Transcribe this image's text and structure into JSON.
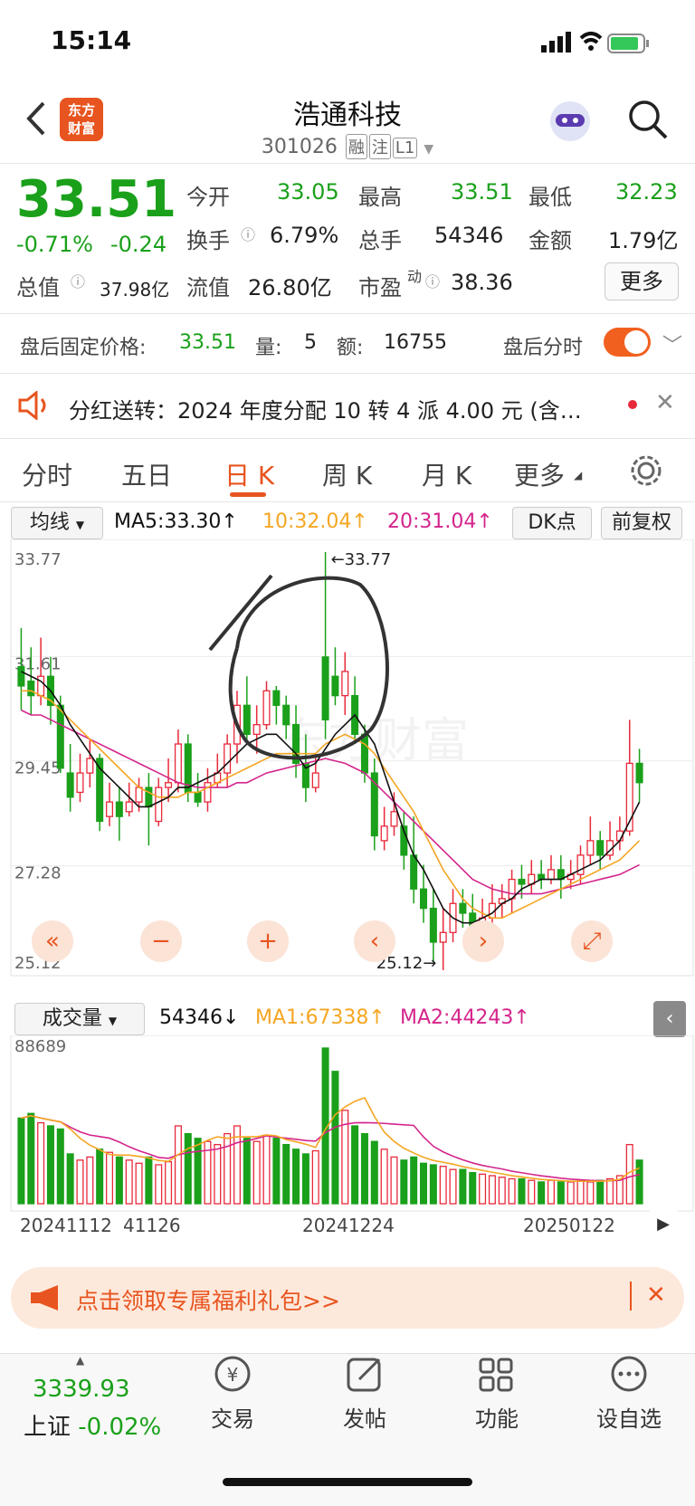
{
  "status": {
    "time": "15:14"
  },
  "header": {
    "title": "浩通科技",
    "code": "301026",
    "tags": [
      "融",
      "注",
      "L1"
    ],
    "logo_text": "东方财富"
  },
  "quote": {
    "price": "33.51",
    "change_pct": "-0.71%",
    "change": "-0.24",
    "fields": [
      {
        "label": "今开",
        "value": "33.05"
      },
      {
        "label": "最高",
        "value": "33.51"
      },
      {
        "label": "最低",
        "value": "32.23"
      },
      {
        "label": "换手",
        "value": "6.79%"
      },
      {
        "label": "总手",
        "value": "54346"
      },
      {
        "label": "金额",
        "value": "1.79亿"
      },
      {
        "label": "总值",
        "value": "37.98亿"
      },
      {
        "label": "流值",
        "value": "26.80亿"
      },
      {
        "label": "市盈",
        "value": "38.36"
      }
    ],
    "pe_sup": "动",
    "more_label": "更多"
  },
  "after_hours": {
    "label": "盘后固定价格:",
    "price": "33.51",
    "vol_label": "量:",
    "vol": "5",
    "amt_label": "额:",
    "amt": "16755",
    "switch_label": "盘后分时"
  },
  "notice": {
    "text": "分红送转：2024 年度分配 10 转 4 派 4.00 元 (含…"
  },
  "tabs": [
    "分时",
    "五日",
    "日 K",
    "周 K",
    "月 K",
    "更多"
  ],
  "ma_bar": {
    "select": "均线",
    "ma5": "MA5:33.30↑",
    "ma10": "10:32.04↑",
    "ma20": "20:31.04↑",
    "dk": "DK点",
    "adj": "前复权"
  },
  "price_axis": [
    "33.77",
    "31.61",
    "29.45",
    "27.28",
    "25.12"
  ],
  "annotations": {
    "high": "←33.77",
    "low": "25.12→"
  },
  "vol_bar": {
    "select": "成交量",
    "vol": "54346↓",
    "ma1": "MA1:67338↑",
    "ma2": "MA2:44243↑",
    "max": "88689"
  },
  "dates": [
    "20241112",
    "41126",
    "20241224",
    "20250122"
  ],
  "banner": {
    "text": "点击领取专属福利礼包>>"
  },
  "bottom": {
    "index_value": "3339.93",
    "index_name": "上证",
    "index_change": "-0.02%",
    "items": [
      "交易",
      "发帖",
      "功能",
      "设自选"
    ]
  },
  "colors": {
    "up": "#e8293a",
    "down": "#1aa01a",
    "ma5": "#111111",
    "ma10": "#f5a623",
    "ma20": "#d4258c",
    "accent": "#e8541f"
  },
  "chart_data": {
    "type": "candlestick",
    "price_range": [
      25.12,
      33.77
    ],
    "volume_max": 88689,
    "candles": [
      [
        31.4,
        31.0,
        32.2,
        30.5,
        "d"
      ],
      [
        31.1,
        30.8,
        31.8,
        30.4,
        "d"
      ],
      [
        30.8,
        31.2,
        32.0,
        30.6,
        "u"
      ],
      [
        31.2,
        30.6,
        31.6,
        30.2,
        "d"
      ],
      [
        30.6,
        29.3,
        30.8,
        29.2,
        "d"
      ],
      [
        29.2,
        28.7,
        29.8,
        28.4,
        "d"
      ],
      [
        28.8,
        29.2,
        29.6,
        28.6,
        "u"
      ],
      [
        29.2,
        29.5,
        29.9,
        28.9,
        "u"
      ],
      [
        29.5,
        28.2,
        29.6,
        28.0,
        "d"
      ],
      [
        28.3,
        28.6,
        29.0,
        28.1,
        "u"
      ],
      [
        28.6,
        28.3,
        28.9,
        27.8,
        "d"
      ],
      [
        28.4,
        28.6,
        29.0,
        28.3,
        "u"
      ],
      [
        28.6,
        28.9,
        29.1,
        28.4,
        "u"
      ],
      [
        28.9,
        28.5,
        29.2,
        27.7,
        "d"
      ],
      [
        28.2,
        28.9,
        29.1,
        28.1,
        "u"
      ],
      [
        28.9,
        29.0,
        29.5,
        28.6,
        "u"
      ],
      [
        29.0,
        29.8,
        30.1,
        28.8,
        "u"
      ],
      [
        29.8,
        28.8,
        30.0,
        28.6,
        "d"
      ],
      [
        28.8,
        28.6,
        29.2,
        28.5,
        "d"
      ],
      [
        28.6,
        29.0,
        29.3,
        28.4,
        "u"
      ],
      [
        29.0,
        29.2,
        29.6,
        28.9,
        "u"
      ],
      [
        29.2,
        29.8,
        30.0,
        28.9,
        "u"
      ],
      [
        29.8,
        30.6,
        30.9,
        29.4,
        "u"
      ],
      [
        30.6,
        30.0,
        31.2,
        29.8,
        "d"
      ],
      [
        30.0,
        30.2,
        30.6,
        29.6,
        "u"
      ],
      [
        30.2,
        30.9,
        31.1,
        30.1,
        "u"
      ],
      [
        30.9,
        30.6,
        31.0,
        30.2,
        "d"
      ],
      [
        30.6,
        30.2,
        30.8,
        29.9,
        "d"
      ],
      [
        30.2,
        29.4,
        30.6,
        29.1,
        "d"
      ],
      [
        29.4,
        28.9,
        30.0,
        28.6,
        "d"
      ],
      [
        28.9,
        29.2,
        29.6,
        28.8,
        "u"
      ],
      [
        30.3,
        31.6,
        33.77,
        29.9,
        "d"
      ],
      [
        31.2,
        30.8,
        31.8,
        30.6,
        "d"
      ],
      [
        30.8,
        31.3,
        31.7,
        30.4,
        "u"
      ],
      [
        30.8,
        30.0,
        31.2,
        29.8,
        "d"
      ],
      [
        30.0,
        29.2,
        30.2,
        29.0,
        "d"
      ],
      [
        29.2,
        27.9,
        29.5,
        27.6,
        "d"
      ],
      [
        27.8,
        28.1,
        28.5,
        27.6,
        "u"
      ],
      [
        28.1,
        28.4,
        28.8,
        27.9,
        "u"
      ],
      [
        28.1,
        27.5,
        28.4,
        27.2,
        "d"
      ],
      [
        27.5,
        26.8,
        28.3,
        26.5,
        "d"
      ],
      [
        26.8,
        26.4,
        27.3,
        26.1,
        "d"
      ],
      [
        26.4,
        25.7,
        26.8,
        25.3,
        "d"
      ],
      [
        25.7,
        25.9,
        26.4,
        25.12,
        "u"
      ],
      [
        25.9,
        26.5,
        26.8,
        25.7,
        "u"
      ],
      [
        26.5,
        26.3,
        26.8,
        26.0,
        "d"
      ],
      [
        26.3,
        25.9,
        26.7,
        25.5,
        "d"
      ],
      [
        25.9,
        26.2,
        26.6,
        25.6,
        "u"
      ],
      [
        26.2,
        26.5,
        26.9,
        26.0,
        "u"
      ],
      [
        26.5,
        26.6,
        26.9,
        26.2,
        "u"
      ],
      [
        26.6,
        27.0,
        27.2,
        26.3,
        "u"
      ],
      [
        27.0,
        26.9,
        27.3,
        26.6,
        "d"
      ],
      [
        26.9,
        27.1,
        27.4,
        26.7,
        "u"
      ],
      [
        27.1,
        27.0,
        27.4,
        26.8,
        "d"
      ],
      [
        27.0,
        27.2,
        27.5,
        26.9,
        "u"
      ],
      [
        27.2,
        27.0,
        27.5,
        26.6,
        "d"
      ],
      [
        27.0,
        27.1,
        27.4,
        26.8,
        "u"
      ],
      [
        27.1,
        27.5,
        27.7,
        26.9,
        "u"
      ],
      [
        27.5,
        27.8,
        28.3,
        27.3,
        "u"
      ],
      [
        27.8,
        27.5,
        28.0,
        27.2,
        "d"
      ],
      [
        27.5,
        27.8,
        28.2,
        27.4,
        "u"
      ],
      [
        27.8,
        28.0,
        28.3,
        27.6,
        "u"
      ],
      [
        28.0,
        29.4,
        30.3,
        27.9,
        "u"
      ],
      [
        29.4,
        29.0,
        29.7,
        28.6,
        "d"
      ]
    ],
    "volumes": [
      55,
      58,
      52,
      50,
      48,
      32,
      28,
      30,
      35,
      33,
      30,
      28,
      26,
      30,
      25,
      27,
      50,
      45,
      42,
      40,
      38,
      45,
      50,
      42,
      40,
      44,
      42,
      38,
      35,
      32,
      34,
      100,
      85,
      60,
      50,
      45,
      40,
      35,
      30,
      28,
      30,
      26,
      25,
      24,
      22,
      22,
      20,
      19,
      18,
      17,
      16,
      16,
      15,
      14,
      15,
      14,
      14,
      15,
      14,
      15,
      16,
      18,
      38,
      28
    ],
    "ma5": [
      31.3,
      31.2,
      31.1,
      30.9,
      30.6,
      30.2,
      29.9,
      29.6,
      29.3,
      29.1,
      28.9,
      28.7,
      28.5,
      28.5,
      28.6,
      28.7,
      28.9,
      28.9,
      29.0,
      29.1,
      29.2,
      29.4,
      29.6,
      29.8,
      29.9,
      30.0,
      30.0,
      29.8,
      29.6,
      29.3,
      29.4,
      29.7,
      30.0,
      30.2,
      30.4,
      30.1,
      29.8,
      29.2,
      28.6,
      28.0,
      27.5,
      27.2,
      26.8,
      26.4,
      26.2,
      26.1,
      26.1,
      26.2,
      26.3,
      26.5,
      26.6,
      26.8,
      26.9,
      27.0,
      27.0,
      27.0,
      27.1,
      27.2,
      27.3,
      27.4,
      27.6,
      27.8,
      28.2,
      28.6
    ],
    "ma10": [
      30.9,
      30.9,
      30.8,
      30.7,
      30.5,
      30.3,
      30.1,
      29.9,
      29.7,
      29.5,
      29.3,
      29.1,
      28.9,
      28.8,
      28.7,
      28.7,
      28.7,
      28.8,
      28.8,
      28.9,
      29.0,
      29.1,
      29.2,
      29.3,
      29.4,
      29.5,
      29.6,
      29.6,
      29.6,
      29.6,
      29.6,
      29.8,
      29.9,
      30.0,
      29.9,
      29.8,
      29.6,
      29.3,
      29.0,
      28.7,
      28.4,
      28.0,
      27.6,
      27.2,
      26.9,
      26.6,
      26.4,
      26.3,
      26.2,
      26.2,
      26.3,
      26.4,
      26.5,
      26.6,
      26.7,
      26.8,
      26.9,
      27.0,
      27.1,
      27.2,
      27.3,
      27.4,
      27.6,
      27.8
    ],
    "ma20": [
      30.5,
      30.4,
      30.4,
      30.3,
      30.2,
      30.1,
      30.0,
      29.9,
      29.8,
      29.7,
      29.6,
      29.5,
      29.4,
      29.3,
      29.2,
      29.1,
      29.0,
      28.95,
      28.9,
      28.9,
      28.9,
      28.9,
      29.0,
      29.0,
      29.1,
      29.2,
      29.25,
      29.3,
      29.35,
      29.4,
      29.45,
      29.5,
      29.45,
      29.4,
      29.3,
      29.2,
      29.0,
      28.8,
      28.6,
      28.4,
      28.2,
      28.0,
      27.8,
      27.6,
      27.4,
      27.2,
      27.0,
      26.9,
      26.8,
      26.75,
      26.7,
      26.7,
      26.7,
      26.7,
      26.75,
      26.8,
      26.85,
      26.9,
      26.95,
      27.0,
      27.05,
      27.1,
      27.2,
      27.3
    ]
  }
}
